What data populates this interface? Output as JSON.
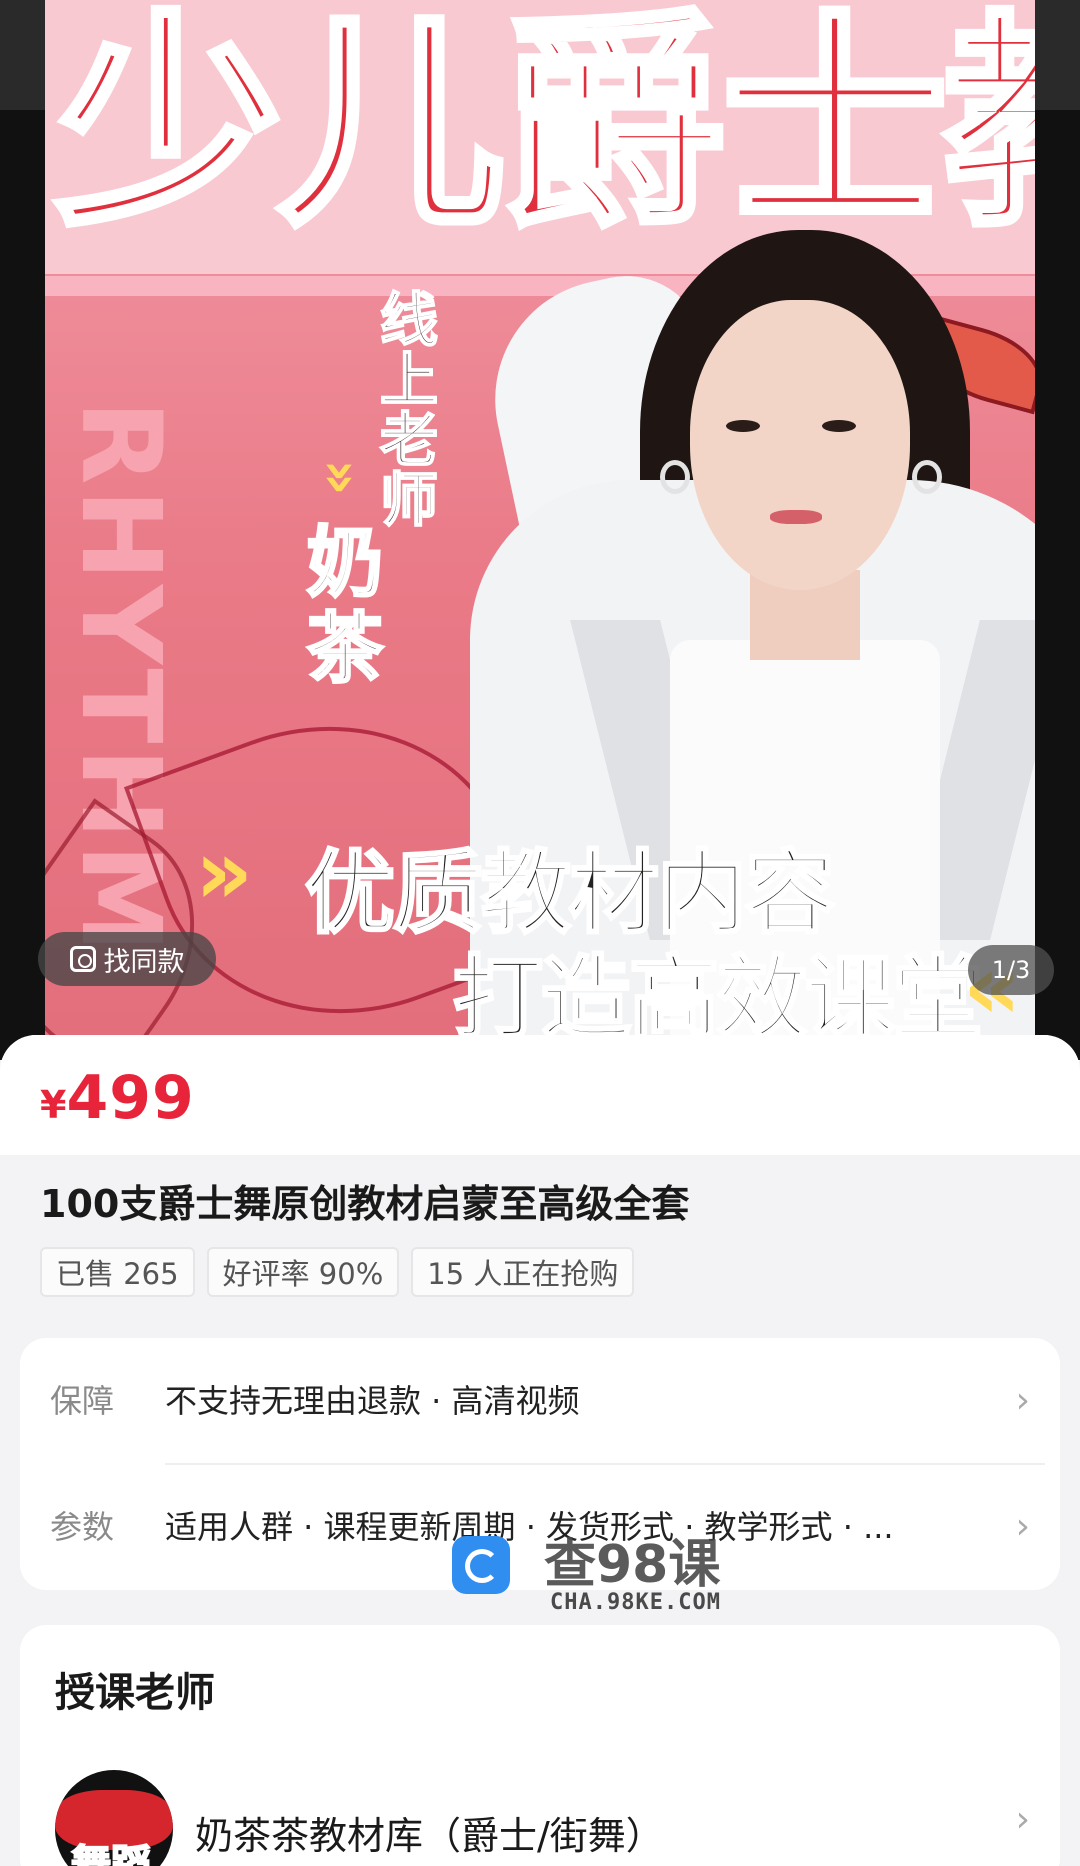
{
  "hero": {
    "poster_title": "少儿爵士教材",
    "vertical_word": "RHYTHM",
    "tag_online": "线上老师",
    "tag_name": "奶茶",
    "slogan_line1": "优质教材内容",
    "slogan_line2": "打造高效课堂",
    "find_same_label": "找同款",
    "pager": "1/3"
  },
  "product": {
    "currency_symbol": "¥",
    "price": "499",
    "title": "100支爵士舞原创教材启蒙至高级全套",
    "chips": [
      "已售 265",
      "好评率 90%",
      "15 人正在抢购"
    ]
  },
  "info": {
    "guarantee_label": "保障",
    "guarantee_value": "不支持无理由退款 · 高清视频",
    "params_label": "参数",
    "params_value": "适用人群 · 课程更新周期 · 发货形式 · 教学形式 · ..."
  },
  "watermark": {
    "main": "查98课",
    "sub": "CHA.98KE.COM"
  },
  "teacher": {
    "section_title": "授课老师",
    "avatar_text": "舞蹈",
    "name": "奶茶茶教材库（爵士/街舞）"
  },
  "colors": {
    "price_red": "#e8243a",
    "poster_pink": "#ea7a87",
    "accent_yellow": "#ffd957"
  }
}
